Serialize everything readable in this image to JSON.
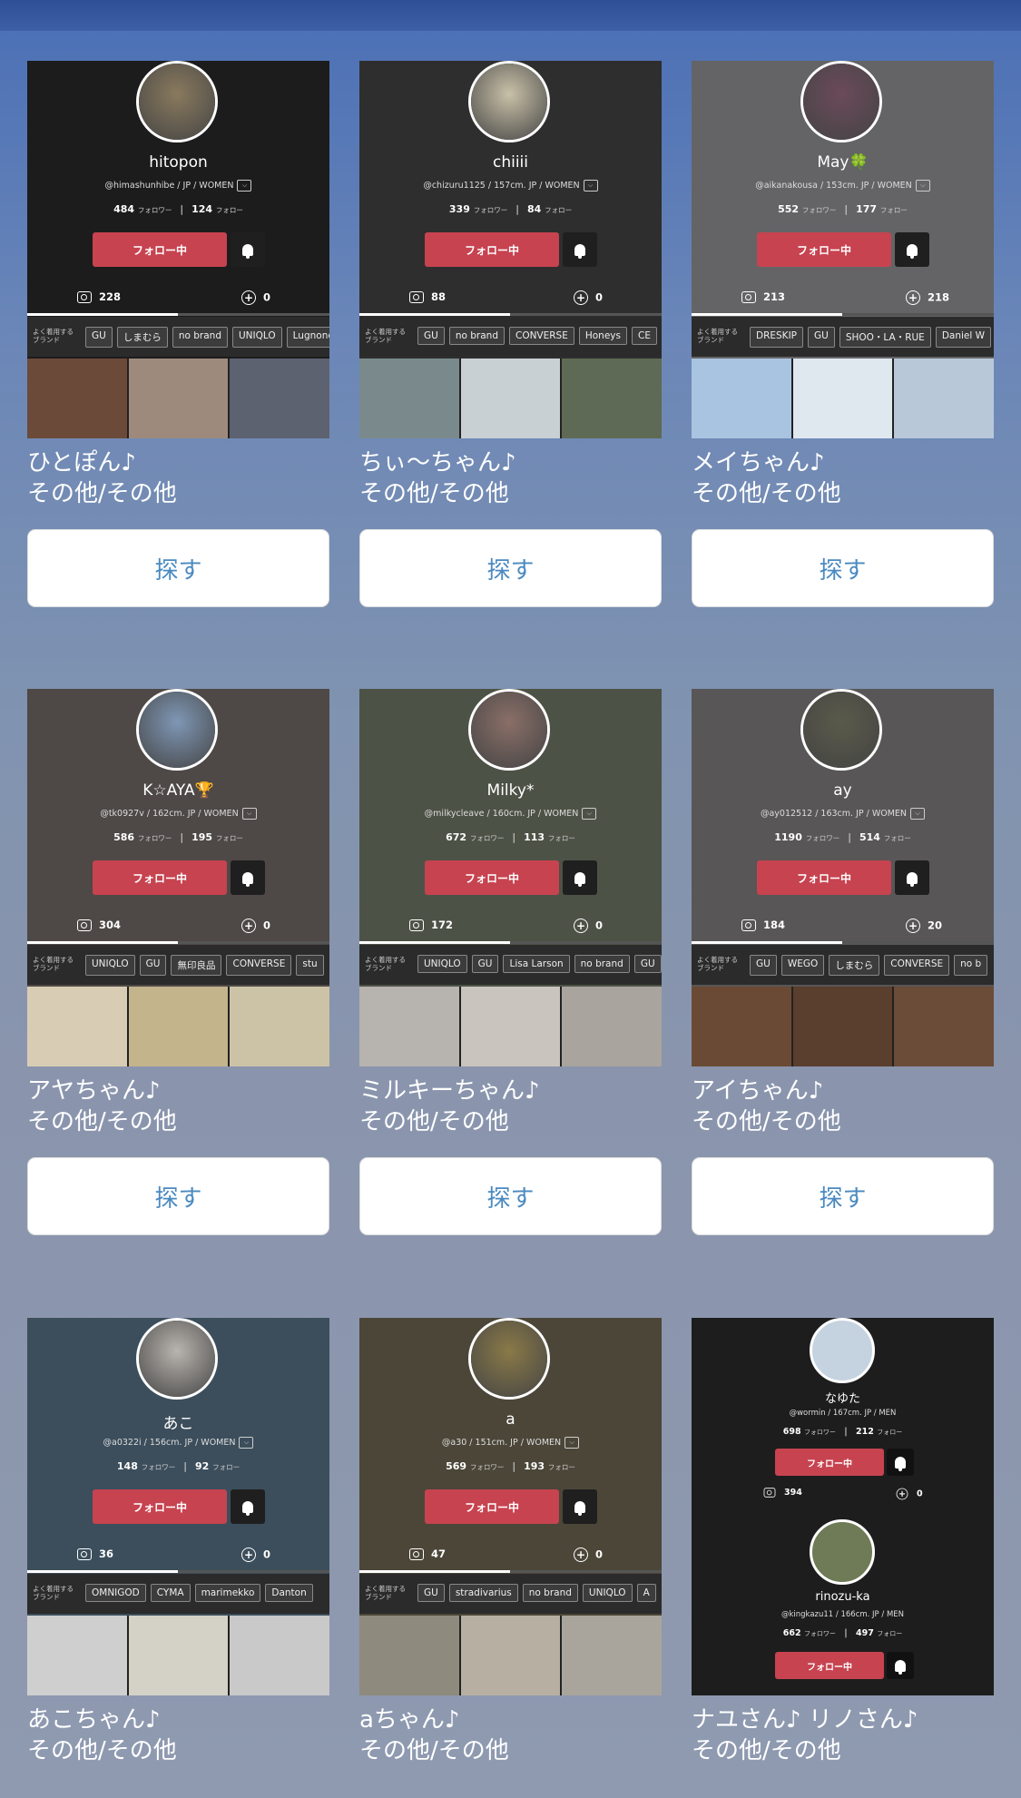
{
  "cards": [
    {
      "name": "hitopon",
      "handle": "@himashunhibe / JP / WOMEN",
      "followers": "484",
      "following": "124",
      "follow_unit": "フォロワー",
      "following_unit": "フォロー",
      "follow_button": "フォロー中",
      "posts": "228",
      "likes": "0",
      "brand_label": "よく着用する\nブランド",
      "brands": [
        "GU",
        "しまむら",
        "no brand",
        "UNIQLO",
        "Lugnoncure"
      ],
      "nickname": "ひとぽん♪",
      "region": "その他/その他",
      "search_label": "探す",
      "bg": "#1c1c1c",
      "avatar_color": "#8a7a5e",
      "photo_colors": [
        "#6b4a3a",
        "#9e8a7d",
        "#5d6270"
      ]
    },
    {
      "name": "chiiii",
      "handle": "@chizuru1125 / 157cm. JP / WOMEN",
      "followers": "339",
      "following": "84",
      "follow_unit": "フォロワー",
      "following_unit": "フォロー",
      "follow_button": "フォロー中",
      "posts": "88",
      "likes": "0",
      "brand_label": "よく着用する\nブランド",
      "brands": [
        "GU",
        "no brand",
        "CONVERSE",
        "Honeys",
        "CE"
      ],
      "nickname": "ちぃ〜ちゃん♪",
      "region": "その他/その他",
      "search_label": "探す",
      "bg": "#2e2e2e",
      "avatar_color": "#c9c1a8",
      "photo_colors": [
        "#7a8a8c",
        "#c8d0d4",
        "#5e6a55"
      ]
    },
    {
      "name": "May🍀",
      "handle": "@aikanakousa / 153cm. JP / WOMEN",
      "followers": "552",
      "following": "177",
      "follow_unit": "フォロワー",
      "following_unit": "フォロー",
      "follow_button": "フォロー中",
      "posts": "213",
      "likes": "218",
      "brand_label": "よく着用する\nブランド",
      "brands": [
        "DRESKIP",
        "GU",
        "SHOO・LA・RUE",
        "Daniel W"
      ],
      "nickname": "メイちゃん♪",
      "region": "その他/その他",
      "search_label": "探す",
      "bg": "#646466",
      "avatar_color": "#6b4a5a",
      "photo_colors": [
        "#a8c4e0",
        "#dfe7ef",
        "#b8c8d8"
      ]
    },
    {
      "name": "K☆AYA🏆",
      "handle": "@tk0927v / 162cm. JP / WOMEN",
      "followers": "586",
      "following": "195",
      "follow_unit": "フォロワー",
      "following_unit": "フォロー",
      "follow_button": "フォロー中",
      "posts": "304",
      "likes": "0",
      "brand_label": "よく着用する\nブランド",
      "brands": [
        "UNIQLO",
        "GU",
        "無印良品",
        "CONVERSE",
        "stu"
      ],
      "nickname": "アヤちゃん♪",
      "region": "その他/その他",
      "search_label": "探す",
      "bg": "#4e4846",
      "avatar_color": "#7f97b5",
      "photo_colors": [
        "#d8cdb4",
        "#c4b48c",
        "#ccc2a6"
      ]
    },
    {
      "name": "Milky*",
      "handle": "@milkycleave / 160cm. JP / WOMEN",
      "followers": "672",
      "following": "113",
      "follow_unit": "フォロワー",
      "following_unit": "フォロー",
      "follow_button": "フォロー中",
      "posts": "172",
      "likes": "0",
      "brand_label": "よく着用する\nブランド",
      "brands": [
        "UNIQLO",
        "GU",
        "Lisa Larson",
        "no brand",
        "GU"
      ],
      "nickname": "ミルキーちゃん♪",
      "region": "その他/その他",
      "search_label": "探す",
      "bg": "#4d5246",
      "avatar_color": "#8a6f68",
      "photo_colors": [
        "#b7b3ae",
        "#c9c4bd",
        "#a9a49d"
      ]
    },
    {
      "name": "ay",
      "handle": "@ay012512 / 163cm. JP / WOMEN",
      "followers": "1190",
      "following": "514",
      "follow_unit": "フォロワー",
      "following_unit": "フォロー",
      "follow_button": "フォロー中",
      "posts": "184",
      "likes": "20",
      "brand_label": "よく着用する\nブランド",
      "brands": [
        "GU",
        "WEGO",
        "しまむら",
        "CONVERSE",
        "no b"
      ],
      "nickname": "アイちゃん♪",
      "region": "その他/その他",
      "search_label": "探す",
      "bg": "#585656",
      "avatar_color": "#5a5a4a",
      "photo_colors": [
        "#6a4a35",
        "#5a3e2e",
        "#6b4c38"
      ]
    },
    {
      "name": "あこ",
      "handle": "@a0322i / 156cm. JP / WOMEN",
      "followers": "148",
      "following": "92",
      "follow_unit": "フォロワー",
      "following_unit": "フォロー",
      "follow_button": "フォロー中",
      "posts": "36",
      "likes": "0",
      "brand_label": "よく着用する\nブランド",
      "brands": [
        "OMNIGOD",
        "CYMA",
        "marimekko",
        "Danton"
      ],
      "nickname": "あこちゃん♪",
      "region": "その他/その他",
      "search_label": "探す",
      "bg": "#3c4e5c",
      "avatar_color": "#b9b4ae",
      "photo_colors": [
        "#cfcfcf",
        "#d4d1c6",
        "#c9c9c9"
      ]
    },
    {
      "name": "a",
      "handle": "@a30 / 151cm. JP / WOMEN",
      "followers": "569",
      "following": "193",
      "follow_unit": "フォロワー",
      "following_unit": "フォロー",
      "follow_button": "フォロー中",
      "posts": "47",
      "likes": "0",
      "brand_label": "よく着用する\nブランド",
      "brands": [
        "GU",
        "stradivarius",
        "no brand",
        "UNIQLO",
        "A"
      ],
      "nickname": "aちゃん♪",
      "region": "その他/その他",
      "search_label": "探す",
      "bg": "#4b4638",
      "avatar_color": "#8a7a48",
      "photo_colors": [
        "#8e8a7e",
        "#b7b0a2",
        "#a9a59c"
      ]
    }
  ],
  "card9": {
    "user1": {
      "name": "なゆた",
      "handle": "@wormin / 167cm. JP / MEN",
      "followers": "698",
      "following": "212",
      "follow_unit": "フォロワー",
      "following_unit": "フォロー",
      "follow_button": "フォロー中",
      "posts": "394",
      "likes": "0"
    },
    "user2": {
      "name": "rinozu-ka",
      "handle": "@kingkazu11 / 166cm. JP / MEN",
      "followers": "662",
      "following": "497",
      "follow_unit": "フォロワー",
      "following_unit": "フォロー",
      "follow_button": "フォロー中"
    },
    "nickname": "ナユさん♪ リノさん♪",
    "region": "その他/その他"
  }
}
